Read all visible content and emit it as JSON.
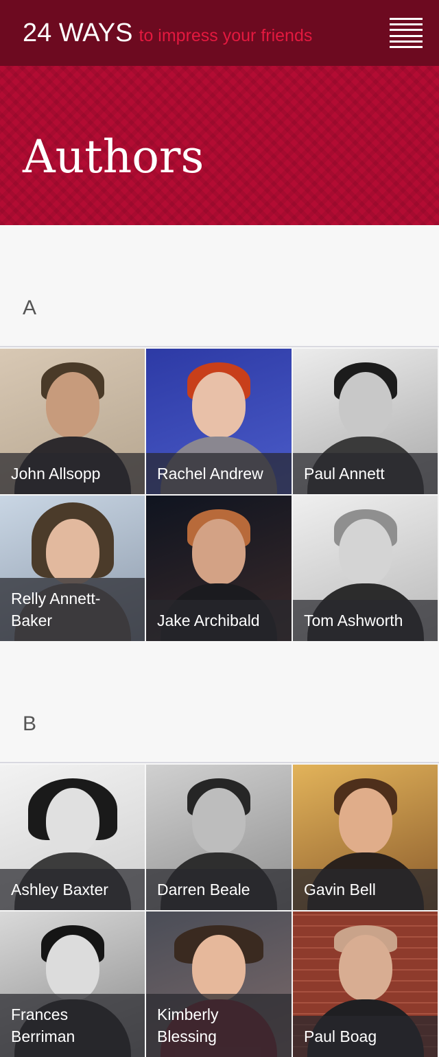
{
  "header": {
    "brand": "24 WAYS",
    "tagline": "to impress your friends"
  },
  "hero": {
    "title": "Authors"
  },
  "sections": [
    {
      "letter": "A",
      "authors": [
        "John Allsopp",
        "Rachel Andrew",
        "Paul Annett",
        "Relly Annett-Baker",
        "Jake Archibald",
        "Tom Ashworth"
      ]
    },
    {
      "letter": "B",
      "authors": [
        "Ashley Baxter",
        "Darren Beale",
        "Gavin Bell",
        "Frances Berriman",
        "Kimberly Blessing",
        "Paul Boag"
      ]
    }
  ],
  "colors": {
    "topbar": "#6d0a20",
    "hero": "#b30c33",
    "tagline": "#e3193f"
  }
}
